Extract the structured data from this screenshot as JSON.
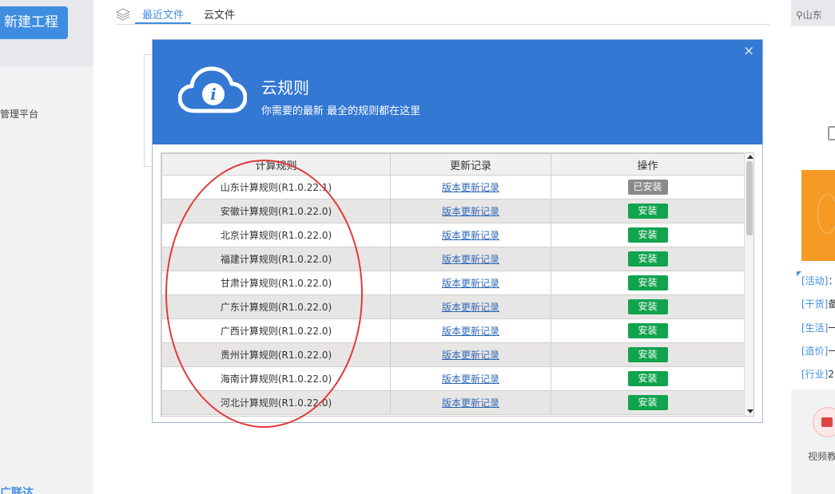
{
  "left_sidebar": {
    "new_project_label": "新建工程",
    "platform_label": "管理平台",
    "bottom_label": "广联达"
  },
  "tabs": [
    {
      "label": "最近文件",
      "active": true
    },
    {
      "label": "云文件",
      "active": false
    }
  ],
  "right_sidebar": {
    "location": "山东",
    "news": [
      {
        "tag": "[活动]",
        "tail": "：",
        "color": "#3f8de0"
      },
      {
        "tag": "[干货]",
        "tail": "备"
      },
      {
        "tag": "[生活]",
        "tail": "一"
      },
      {
        "tag": "[造价]",
        "tail": "一"
      },
      {
        "tag": "[行业]",
        "tail": "2"
      }
    ],
    "video_label": "视频教"
  },
  "dialog": {
    "title": "云规则",
    "subtitle": "你需要的最新 最全的规则都在这里",
    "close_glyph": "×",
    "columns": [
      "计算规则",
      "更新记录",
      "操作"
    ],
    "rows": [
      {
        "name": "山东计算规则(R1.0.22.1)",
        "link": "版本更新记录",
        "action": "已安装",
        "installed": true
      },
      {
        "name": "安徽计算规则(R1.0.22.0)",
        "link": "版本更新记录",
        "action": "安装",
        "installed": false
      },
      {
        "name": "北京计算规则(R1.0.22.0)",
        "link": "版本更新记录",
        "action": "安装",
        "installed": false
      },
      {
        "name": "福建计算规则(R1.0.22.0)",
        "link": "版本更新记录",
        "action": "安装",
        "installed": false
      },
      {
        "name": "甘肃计算规则(R1.0.22.0)",
        "link": "版本更新记录",
        "action": "安装",
        "installed": false
      },
      {
        "name": "广东计算规则(R1.0.22.0)",
        "link": "版本更新记录",
        "action": "安装",
        "installed": false
      },
      {
        "name": "广西计算规则(R1.0.22.0)",
        "link": "版本更新记录",
        "action": "安装",
        "installed": false
      },
      {
        "name": "贵州计算规则(R1.0.22.0)",
        "link": "版本更新记录",
        "action": "安装",
        "installed": false
      },
      {
        "name": "海南计算规则(R1.0.22.0)",
        "link": "版本更新记录",
        "action": "安装",
        "installed": false
      },
      {
        "name": "河北计算规则(R1.0.22.0)",
        "link": "版本更新记录",
        "action": "安装",
        "installed": false
      }
    ]
  },
  "colors": {
    "header_blue": "#3378d3",
    "install_green": "#11a34f",
    "installed_gray": "#8a8a8a",
    "annotation_red": "#e03a3a"
  }
}
